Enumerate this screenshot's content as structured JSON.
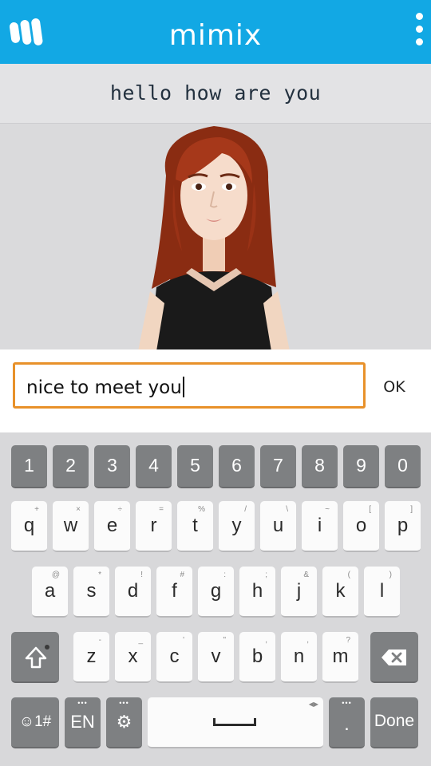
{
  "header": {
    "app_title": "mimix",
    "logo_icon": "mimix-logo-icon",
    "menu_icon": "overflow-menu-icon",
    "bg_color": "#12a8e4"
  },
  "stage": {
    "caption": "hello how are you",
    "avatar": "3d-avatar-woman-red-hair"
  },
  "input": {
    "value": "nice to meet you",
    "ok_label": "OK",
    "focus_color": "#e8912a"
  },
  "keyboard": {
    "number_row": [
      "1",
      "2",
      "3",
      "4",
      "5",
      "6",
      "7",
      "8",
      "9",
      "0"
    ],
    "row1": [
      {
        "key": "q",
        "hint": "+"
      },
      {
        "key": "w",
        "hint": "×"
      },
      {
        "key": "e",
        "hint": "÷"
      },
      {
        "key": "r",
        "hint": "="
      },
      {
        "key": "t",
        "hint": "%"
      },
      {
        "key": "y",
        "hint": "/"
      },
      {
        "key": "u",
        "hint": "\\"
      },
      {
        "key": "i",
        "hint": "~"
      },
      {
        "key": "o",
        "hint": "["
      },
      {
        "key": "p",
        "hint": "]"
      }
    ],
    "row2": [
      {
        "key": "a",
        "hint": "@"
      },
      {
        "key": "s",
        "hint": "*"
      },
      {
        "key": "d",
        "hint": "!"
      },
      {
        "key": "f",
        "hint": "#"
      },
      {
        "key": "g",
        "hint": ":"
      },
      {
        "key": "h",
        "hint": ";"
      },
      {
        "key": "j",
        "hint": "&"
      },
      {
        "key": "k",
        "hint": "("
      },
      {
        "key": "l",
        "hint": ")"
      }
    ],
    "row3": [
      {
        "key": "z",
        "hint": "-"
      },
      {
        "key": "x",
        "hint": "_"
      },
      {
        "key": "c",
        "hint": "'"
      },
      {
        "key": "v",
        "hint": "\""
      },
      {
        "key": "b",
        "hint": ","
      },
      {
        "key": "n",
        "hint": ","
      },
      {
        "key": "m",
        "hint": "?"
      }
    ],
    "symbols_label": "☺1#",
    "language_label": "EN",
    "period_label": ".",
    "done_label": "Done",
    "shift_icon": "shift-icon",
    "backspace_icon": "backspace-icon",
    "settings_icon": "gear-icon",
    "space_icon": "space-bar-icon"
  }
}
